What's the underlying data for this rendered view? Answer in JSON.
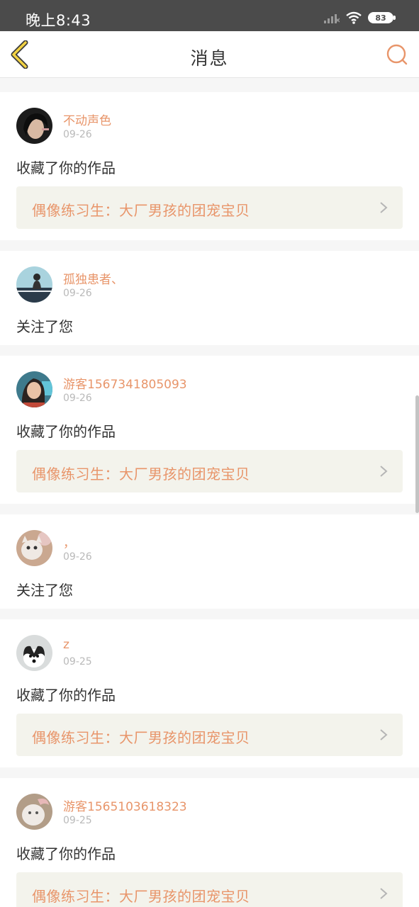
{
  "status": {
    "time": "晚上8:43",
    "battery": "83"
  },
  "nav": {
    "title": "消息",
    "back_icon": "chevron-left-icon",
    "search_icon": "search-icon"
  },
  "accent": "#e8956a",
  "messages": [
    {
      "user": "不动声色",
      "date": "09-26",
      "action": "收藏了你的作品",
      "work": "偶像练习生：大厂男孩的团宠宝贝"
    },
    {
      "user": "孤独患者、",
      "date": "09-26",
      "action": "关注了您"
    },
    {
      "user": "游客1567341805093",
      "date": "09-26",
      "action": "收藏了你的作品",
      "work": "偶像练习生：大厂男孩的团宠宝贝"
    },
    {
      "user": "，",
      "date": "09-26",
      "action": "关注了您"
    },
    {
      "user": "z",
      "date": "09-25",
      "action": "收藏了你的作品",
      "work": "偶像练习生：大厂男孩的团宠宝贝"
    },
    {
      "user": "游客1565103618323",
      "date": "09-25",
      "action": "收藏了你的作品",
      "work": "偶像练习生：大厂男孩的团宠宝贝"
    }
  ]
}
